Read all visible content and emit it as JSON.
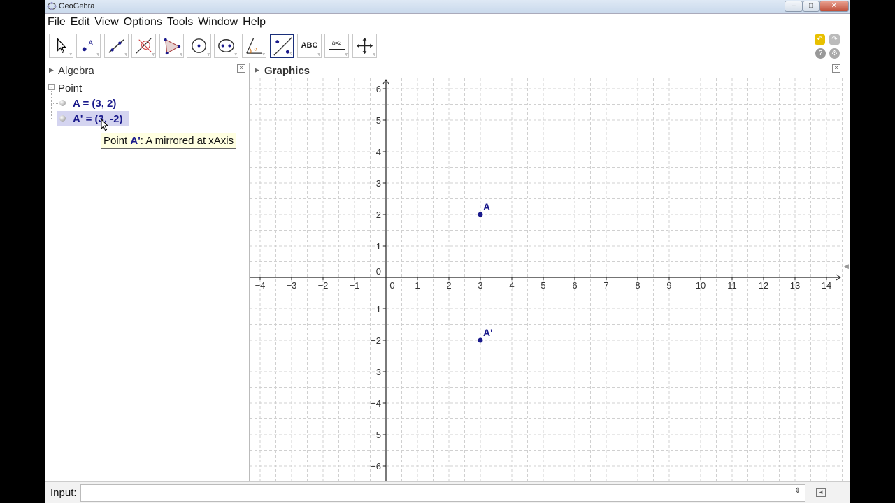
{
  "window": {
    "title": "GeoGebra"
  },
  "menu": [
    "File",
    "Edit",
    "View",
    "Options",
    "Tools",
    "Window",
    "Help"
  ],
  "toolbar": {
    "tools": [
      {
        "name": "move-tool"
      },
      {
        "name": "point-tool"
      },
      {
        "name": "line-tool"
      },
      {
        "name": "perpendicular-line-tool"
      },
      {
        "name": "polygon-tool"
      },
      {
        "name": "circle-center-point-tool"
      },
      {
        "name": "ellipse-tool"
      },
      {
        "name": "angle-tool"
      },
      {
        "name": "reflect-about-line-tool",
        "selected": true
      },
      {
        "name": "text-tool",
        "label": "ABC"
      },
      {
        "name": "slider-tool",
        "label": "a=2"
      },
      {
        "name": "move-graphics-view-tool"
      }
    ]
  },
  "algebra": {
    "header": "Algebra",
    "category": "Point",
    "items": [
      {
        "text": "A = (3, 2)"
      },
      {
        "text": "A' = (3, -2)",
        "selected": true
      }
    ],
    "tooltip": {
      "prefix": "Point ",
      "name": "A'",
      "suffix": ": A mirrored at xAxis"
    }
  },
  "graphics": {
    "header": "Graphics",
    "x_ticks": [
      -4,
      -3,
      -2,
      -1,
      0,
      1,
      2,
      3,
      4,
      5,
      6,
      7,
      8,
      9,
      10,
      11,
      12,
      13,
      14
    ],
    "y_ticks": [
      6,
      5,
      4,
      3,
      2,
      1,
      0,
      -1,
      -2,
      -3,
      -4,
      -5,
      -6
    ],
    "x_range": [
      -4.4,
      14.5
    ],
    "y_range": [
      -6.6,
      6.3
    ],
    "points": [
      {
        "label": "A",
        "x": 3,
        "y": 2
      },
      {
        "label": "A'",
        "x": 3,
        "y": -2
      }
    ],
    "point_color": "#1a1a8c"
  },
  "input": {
    "label": "Input:",
    "value": ""
  }
}
